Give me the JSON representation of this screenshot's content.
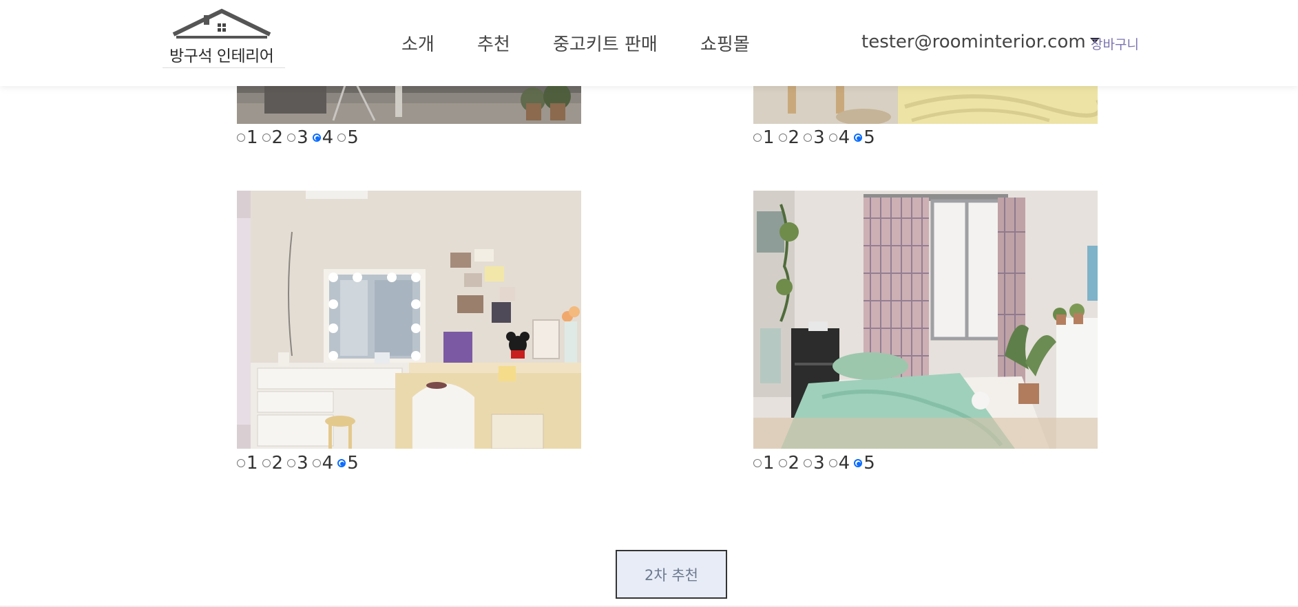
{
  "header": {
    "logo_text": "방구석 인테리어",
    "nav": [
      {
        "label": "소개"
      },
      {
        "label": "추천"
      },
      {
        "label": "중고키트 판매"
      },
      {
        "label": "쇼핑몰"
      }
    ],
    "user_email": "tester@roominterior.com",
    "cart_label": "장바구니"
  },
  "gallery": {
    "rating_options": [
      "1",
      "2",
      "3",
      "4",
      "5"
    ],
    "items": [
      {
        "image": "study-desk-room-photo",
        "selected": "4"
      },
      {
        "image": "yellow-blanket-bed-photo",
        "selected": "5"
      },
      {
        "image": "vanity-mirror-desk-photo",
        "selected": "5"
      },
      {
        "image": "mint-bedding-window-photo",
        "selected": "5"
      }
    ]
  },
  "submit_label": "2차 추천",
  "colors": {
    "accent": "#0a6cff",
    "cart_link": "#7b73b0",
    "button_bg": "#e8ecf6"
  }
}
